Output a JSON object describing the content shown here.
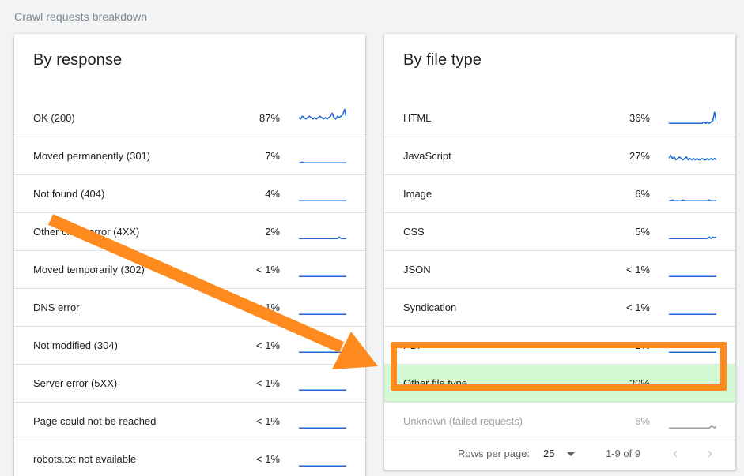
{
  "page": {
    "title": "Crawl requests breakdown"
  },
  "by_response": {
    "title": "By response",
    "rows": [
      {
        "label": "OK (200)",
        "pct": "87%",
        "spark": [
          6,
          5,
          7,
          6,
          5,
          6,
          7,
          6,
          5,
          6,
          5,
          6,
          7,
          6,
          5,
          6,
          5,
          6,
          7,
          9,
          6,
          5,
          7,
          6,
          7,
          8,
          12,
          6
        ]
      },
      {
        "label": "Moved permanently (301)",
        "pct": "7%",
        "spark": [
          1,
          1,
          1.5,
          1,
          1,
          1,
          1,
          1,
          1,
          1,
          1,
          1,
          1,
          1,
          1,
          1,
          1,
          1,
          1,
          1,
          1,
          1,
          1,
          1,
          1,
          1,
          1,
          1
        ]
      },
      {
        "label": "Not found (404)",
        "pct": "4%",
        "spark": [
          1,
          1,
          1,
          1,
          1,
          1,
          1,
          1,
          1,
          1,
          1,
          1,
          1,
          1,
          1,
          1,
          1,
          1,
          1,
          1,
          1,
          1,
          1,
          1,
          1,
          1,
          1,
          1
        ]
      },
      {
        "label": "Other client error (4XX)",
        "pct": "2%",
        "spark": [
          1,
          1,
          1,
          1,
          1,
          1,
          1,
          1,
          1,
          1,
          1,
          1,
          1,
          1,
          1,
          1,
          1,
          1,
          1,
          1,
          1,
          1,
          1,
          2,
          1,
          1,
          1,
          1
        ]
      },
      {
        "label": "Moved temporarily (302)",
        "pct": "< 1%",
        "spark": [
          1,
          1,
          1,
          1,
          1,
          1,
          1,
          1,
          1,
          1,
          1,
          1,
          1,
          1,
          1,
          1,
          1,
          1,
          1,
          1,
          1,
          1,
          1,
          1,
          1,
          1,
          1,
          1
        ]
      },
      {
        "label": "DNS error",
        "pct": "< 1%",
        "spark": [
          1,
          1,
          1,
          1,
          1,
          1,
          1,
          1,
          1,
          1,
          1,
          1,
          1,
          1,
          1,
          1,
          1,
          1,
          1,
          1,
          1,
          1,
          1,
          1,
          1,
          1,
          1,
          1
        ]
      },
      {
        "label": "Not modified (304)",
        "pct": "< 1%",
        "spark": [
          1,
          1,
          1,
          1,
          1,
          1,
          1,
          1,
          1,
          1,
          1,
          1,
          1,
          1,
          1,
          1,
          1,
          1,
          1,
          1,
          1,
          1,
          1,
          1,
          1,
          1,
          1,
          1
        ]
      },
      {
        "label": "Server error (5XX)",
        "pct": "< 1%",
        "spark": [
          1,
          1,
          1,
          1,
          1,
          1,
          1,
          1,
          1,
          1,
          1,
          1,
          1,
          1,
          1,
          1,
          1,
          1,
          1,
          1,
          1,
          1,
          1,
          1,
          1,
          1,
          1,
          1
        ]
      },
      {
        "label": "Page could not be reached",
        "pct": "< 1%",
        "spark": [
          1,
          1,
          1,
          1,
          1,
          1,
          1,
          1,
          1,
          1,
          1,
          1,
          1,
          1,
          1,
          1,
          1,
          1,
          1,
          1,
          1,
          1,
          1,
          1,
          1,
          1,
          1,
          1
        ]
      },
      {
        "label": "robots.txt not available",
        "pct": "< 1%",
        "spark": [
          1,
          1,
          1,
          1,
          1,
          1,
          1,
          1,
          1,
          1,
          1,
          1,
          1,
          1,
          1,
          1,
          1,
          1,
          1,
          1,
          1,
          1,
          1,
          1,
          1,
          1,
          1,
          1
        ]
      }
    ]
  },
  "by_file_type": {
    "title": "By file type",
    "rows": [
      {
        "label": "HTML",
        "pct": "36%",
        "spark": [
          2,
          2,
          2,
          2,
          2,
          2,
          2,
          2,
          2,
          2,
          2,
          2,
          2,
          2,
          2,
          2,
          2,
          2,
          2,
          2,
          3,
          2,
          3,
          2,
          3,
          4,
          10,
          3
        ]
      },
      {
        "label": "JavaScript",
        "pct": "27%",
        "spark": [
          4,
          6,
          4,
          5,
          3,
          4,
          5,
          4,
          3,
          4,
          5,
          3,
          4,
          3,
          4,
          3,
          4,
          3,
          3,
          4,
          3,
          3,
          4,
          3,
          4,
          3,
          4,
          3
        ]
      },
      {
        "label": "Image",
        "pct": "6%",
        "spark": [
          1,
          1,
          1.5,
          1,
          1,
          1,
          1,
          1,
          1.5,
          1,
          1,
          1,
          1,
          1,
          1,
          1,
          1,
          1,
          1,
          1,
          1,
          1,
          1,
          1.5,
          1,
          1,
          1,
          1
        ]
      },
      {
        "label": "CSS",
        "pct": "5%",
        "spark": [
          1,
          1,
          1,
          1,
          1,
          1,
          1,
          1,
          1,
          1,
          1,
          1,
          1,
          1,
          1,
          1,
          1,
          1,
          1,
          1,
          1,
          1,
          1,
          2,
          1,
          2,
          1.5,
          2
        ]
      },
      {
        "label": "JSON",
        "pct": "< 1%",
        "spark": [
          1,
          1,
          1,
          1,
          1,
          1,
          1,
          1,
          1,
          1,
          1,
          1,
          1,
          1,
          1,
          1,
          1,
          1,
          1,
          1,
          1,
          1,
          1,
          1,
          1,
          1,
          1,
          1
        ]
      },
      {
        "label": "Syndication",
        "pct": "< 1%",
        "spark": [
          1,
          1,
          1,
          1,
          1,
          1,
          1,
          1,
          1,
          1,
          1,
          1,
          1,
          1,
          1,
          1,
          1,
          1,
          1,
          1,
          1,
          1,
          1,
          1,
          1,
          1,
          1,
          1
        ]
      },
      {
        "label": "PDF",
        "pct": "< 1%",
        "spark": [
          1,
          1,
          1,
          1,
          1,
          1,
          1,
          1,
          1,
          1,
          1,
          1,
          1,
          1,
          1,
          1,
          1,
          1,
          1,
          1,
          1,
          1,
          1,
          1,
          1,
          1,
          1,
          1
        ]
      },
      {
        "label": "Other file type",
        "pct": "20%",
        "spark": [
          2,
          3,
          2,
          2,
          2,
          2,
          3,
          2,
          2,
          2,
          2,
          2,
          2,
          2,
          2,
          2,
          2,
          2,
          2,
          2,
          2,
          2,
          2,
          2,
          2,
          2,
          3,
          2
        ],
        "highlighted": true
      },
      {
        "label": "Unknown (failed requests)",
        "pct": "6%",
        "spark": [
          1,
          1,
          1,
          1,
          1,
          1,
          1,
          1,
          1,
          1,
          1,
          1,
          1,
          1,
          1,
          1,
          1,
          1,
          1,
          1,
          1,
          1,
          1,
          1,
          2,
          2,
          1,
          2
        ],
        "muted": true
      }
    ],
    "footer": {
      "rows_per_page_label": "Rows per page:",
      "rows_per_page_value": "25",
      "range": "1-9 of 9",
      "prev_glyph": "‹",
      "next_glyph": "›"
    }
  },
  "colors": {
    "spark": "#1a73e8",
    "spark_dark": "#1967d2",
    "spark_muted": "#9aa0a6",
    "highlight_fill": "#d4f7d4",
    "annotation_orange": "#ff8a1d"
  }
}
